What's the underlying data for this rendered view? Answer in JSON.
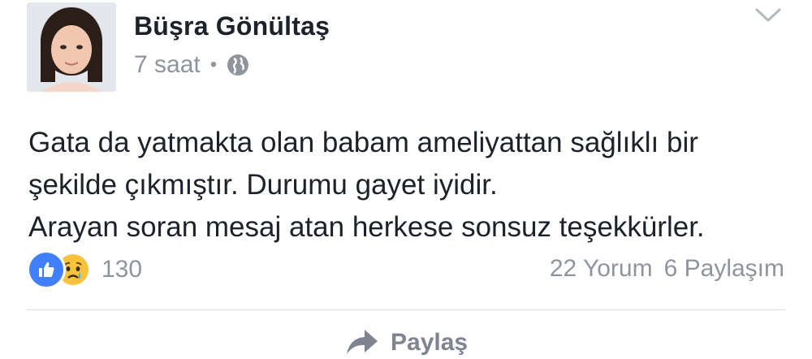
{
  "post": {
    "author": "Büşra Gönültaş",
    "time": "7 saat",
    "separator": "•",
    "privacy_icon": "globe-icon",
    "text_lines": [
      "Gata da yatmakta olan babam ameliyattan sağlıklı bir",
      "şekilde çıkmıştır. Durumu gayet iyidir.",
      "Arayan soran mesaj atan herkese sonsuz teşekkürler."
    ]
  },
  "stats": {
    "reactions": [
      "like",
      "sad"
    ],
    "reaction_count": "130",
    "comments": "22 Yorum",
    "shares": "6 Paylaşım"
  },
  "actions": {
    "share_label": "Paylaş"
  },
  "colors": {
    "like_blue": "#4080ff",
    "sad_yellow": "#f7c23c",
    "meta_gray": "#90949c",
    "text": "#1d2129"
  }
}
